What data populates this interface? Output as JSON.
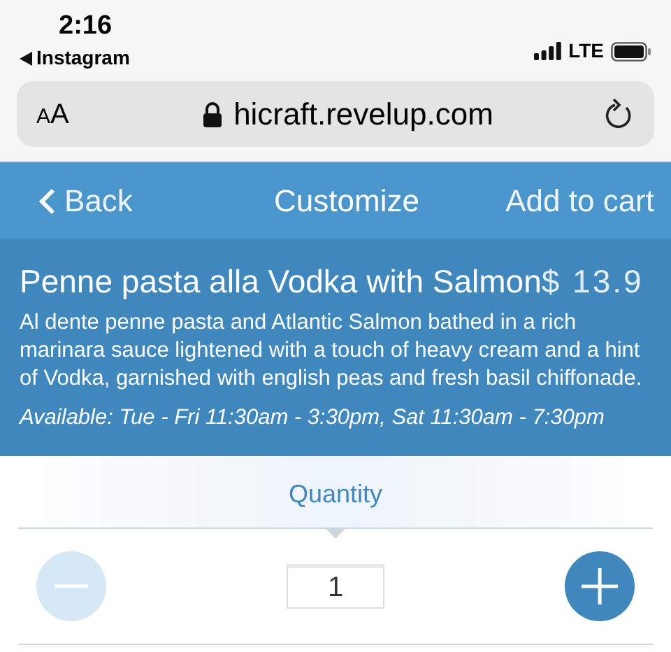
{
  "status_bar": {
    "time": "2:16",
    "back_app": "Instagram",
    "network": "LTE"
  },
  "browser_bar": {
    "text_size": "AA",
    "url": "hicraft.revelup.com"
  },
  "nav": {
    "back": "Back",
    "title": "Customize",
    "action": "Add to cart"
  },
  "product": {
    "name": "Penne pasta alla Vodka with Salmon",
    "price": "$ 13.9",
    "description": "Al dente penne pasta and Atlantic Salmon bathed in a rich marinara sauce lightened with a touch of heavy cream and a hint of Vodka, garnished with english peas and fresh basil chiffonade.",
    "availability": "Available: Tue - Fri 11:30am - 3:30pm, Sat 11:30am - 7:30pm"
  },
  "quantity": {
    "label": "Quantity",
    "value": "1",
    "decrease_disabled": true,
    "increase_disabled": false
  }
}
